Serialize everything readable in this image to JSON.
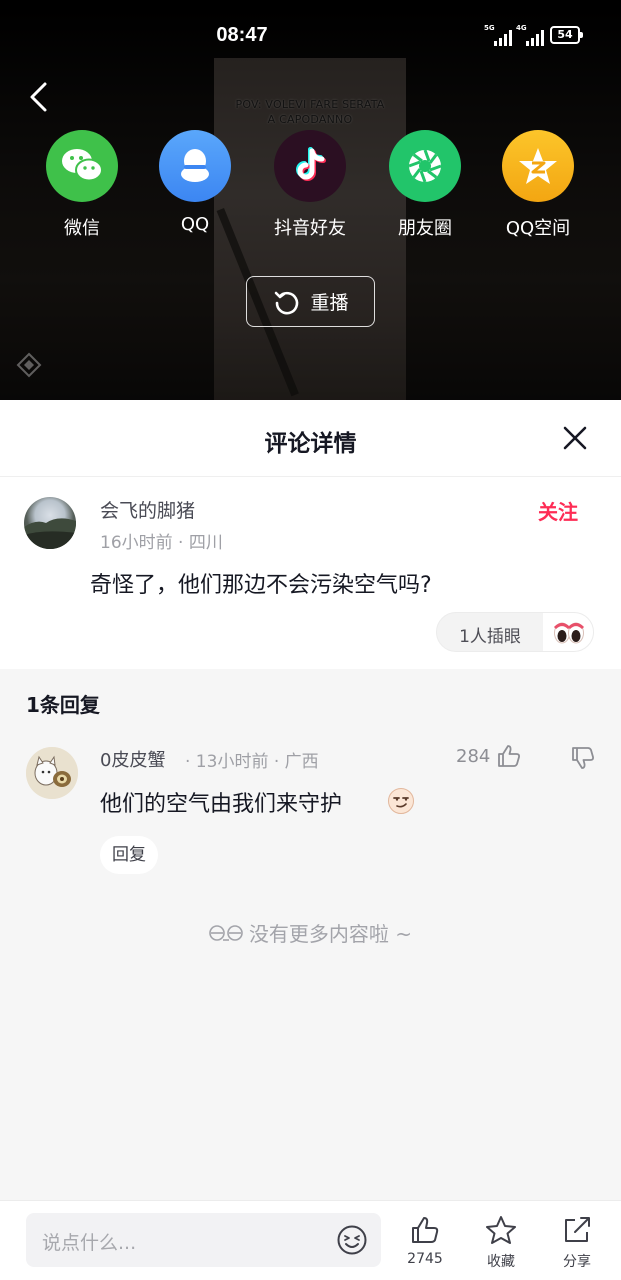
{
  "status_bar": {
    "time": "08:47",
    "signal1_label": "5G",
    "signal2_label": "4G",
    "battery": "54"
  },
  "video": {
    "caption_line1": "POV: VOLEVI FARE SERATA",
    "caption_line2": "A CAPODANNO"
  },
  "share": {
    "items": [
      {
        "label": "微信",
        "icon": "wechat-icon",
        "color": "#3fc14a"
      },
      {
        "label": "QQ",
        "icon": "qq-icon",
        "color": "#3f8ff5"
      },
      {
        "label": "抖音好友",
        "icon": "douyin-icon",
        "color": "#2a1020"
      },
      {
        "label": "朋友圈",
        "icon": "moments-icon",
        "color": "#22c56a"
      },
      {
        "label": "QQ空间",
        "icon": "qzone-icon",
        "color": "#f6b21a"
      }
    ],
    "replay_label": "重播"
  },
  "sheet": {
    "title": "评论详情"
  },
  "comment": {
    "username": "会飞的脚猪",
    "meta": "16小时前 · 四川",
    "follow_label": "关注",
    "text": "奇怪了，他们那边不会污染空气吗?",
    "reaction_label": "1人插眼"
  },
  "replies": {
    "title": "1条回复",
    "items": [
      {
        "username": "0皮皮蟹",
        "meta": "· 13小时前 · 广西",
        "likes": "284",
        "text": "他们的空气由我们来守护",
        "reply_label": "回复"
      }
    ],
    "no_more": "没有更多内容啦 ~"
  },
  "bottom_bar": {
    "input_placeholder": "说点什么...",
    "like_count": "2745",
    "favorite_label": "收藏",
    "share_label": "分享"
  },
  "colors": {
    "accent": "#fe2c55",
    "text_primary": "#161823",
    "text_secondary": "#9fa0a6"
  }
}
